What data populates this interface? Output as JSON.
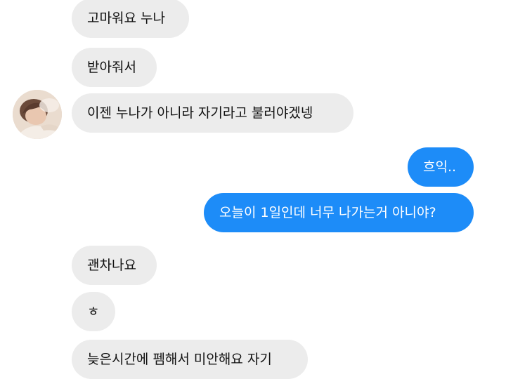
{
  "messages": [
    {
      "sender": "them",
      "text": "고마워요 누나"
    },
    {
      "sender": "them",
      "text": "받아줘서"
    },
    {
      "sender": "them",
      "text": "이젠 누나가 아니라 자기라고 불러야겠넹"
    },
    {
      "sender": "me",
      "text": "흐익.."
    },
    {
      "sender": "me",
      "text": "오늘이 1일인데 너무 나가는거 아니야?"
    },
    {
      "sender": "them",
      "text": "괜차나요"
    },
    {
      "sender": "them",
      "text": "ㅎ"
    },
    {
      "sender": "them",
      "text": "늦은시간에 펨해서 미안해요 자기"
    }
  ],
  "avatar": {
    "icon": "contact-avatar"
  },
  "colors": {
    "outgoing_bubble": "#1d8cf8",
    "incoming_bubble": "#ececec",
    "incoming_text": "#111111",
    "outgoing_text": "#ffffff"
  }
}
